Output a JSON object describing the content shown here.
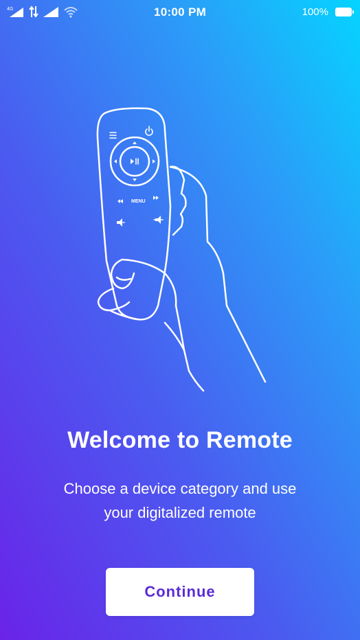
{
  "status_bar": {
    "network_label": "4G",
    "time": "10:00 PM",
    "battery": "100%",
    "icons": [
      "signal-icon",
      "data-transfer-icon",
      "signal-icon",
      "wifi-icon",
      "battery-icon"
    ]
  },
  "illustration": {
    "icon": "hand-holding-remote-illustration",
    "remote_menu_label": "MENU"
  },
  "welcome": {
    "title": "Welcome to Remote",
    "subtitle_line1": "Choose a device category and use",
    "subtitle_line2": "your digitalized remote"
  },
  "actions": {
    "continue_label": "Continue"
  },
  "colors": {
    "gradient_top": "#05d4ff",
    "gradient_bottom": "#6a23e8",
    "button_text": "#5a2ad6",
    "button_bg": "#ffffff"
  }
}
